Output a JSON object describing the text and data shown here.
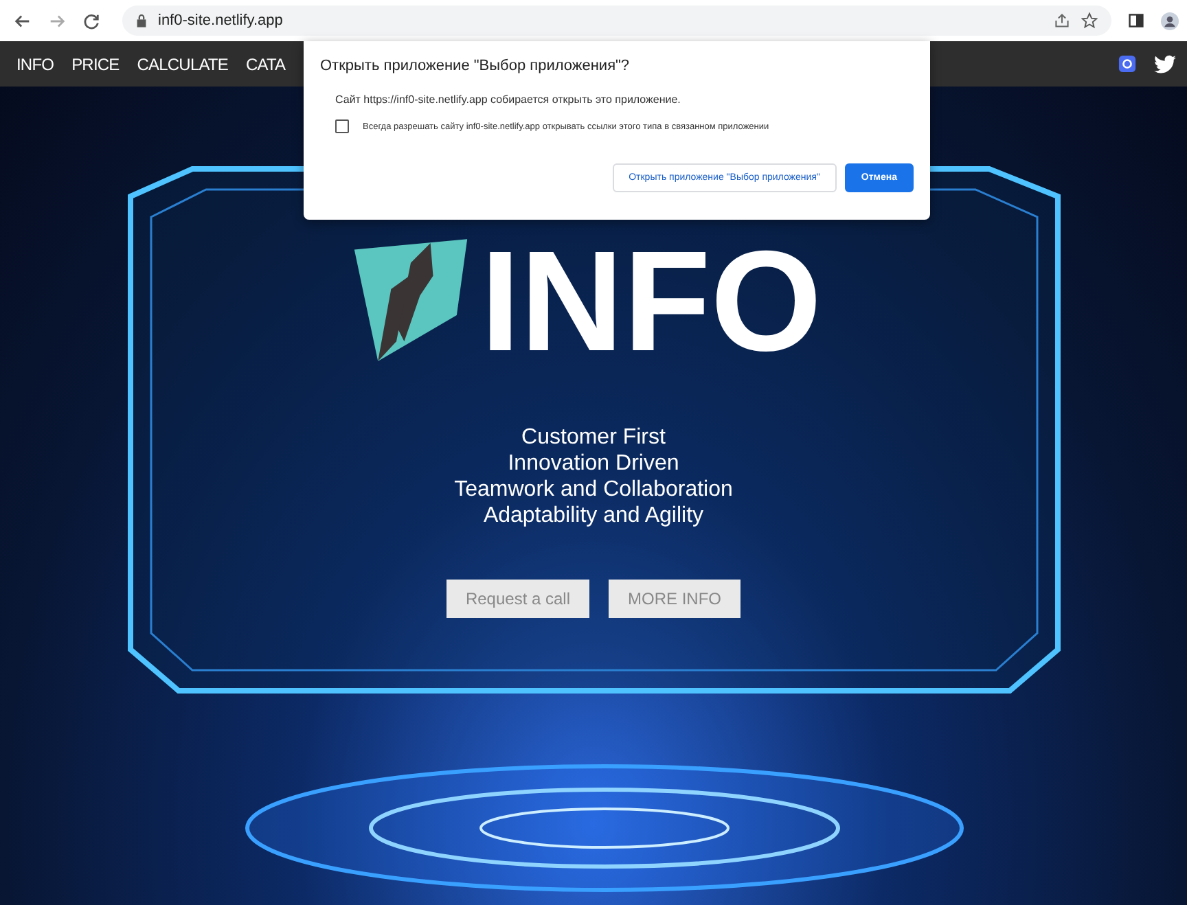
{
  "browser": {
    "url": "inf0-site.netlify.app"
  },
  "site_nav": {
    "items": [
      "INFO",
      "PRICE",
      "CALCULATE",
      "CATA"
    ]
  },
  "dialog": {
    "title": "Открыть приложение \"Выбор приложения\"?",
    "message": "Сайт https://inf0-site.netlify.app собирается открыть это приложение.",
    "checkbox": {
      "label": "Всегда разрешать сайту inf0-site.netlify.app открывать ссылки этого типа в связанном приложении",
      "checked": false
    },
    "buttons": [
      {
        "label": "Открыть приложение \"Выбор приложения\"",
        "kind": "secondary"
      },
      {
        "label": "Отмена",
        "kind": "primary"
      }
    ]
  },
  "hero": {
    "title": "INFO",
    "taglines": [
      "Customer First",
      "Innovation Driven",
      "Teamwork and Collaboration",
      "Adaptability and Agility"
    ],
    "buttons": [
      "Request a call",
      "MORE INFO"
    ]
  }
}
